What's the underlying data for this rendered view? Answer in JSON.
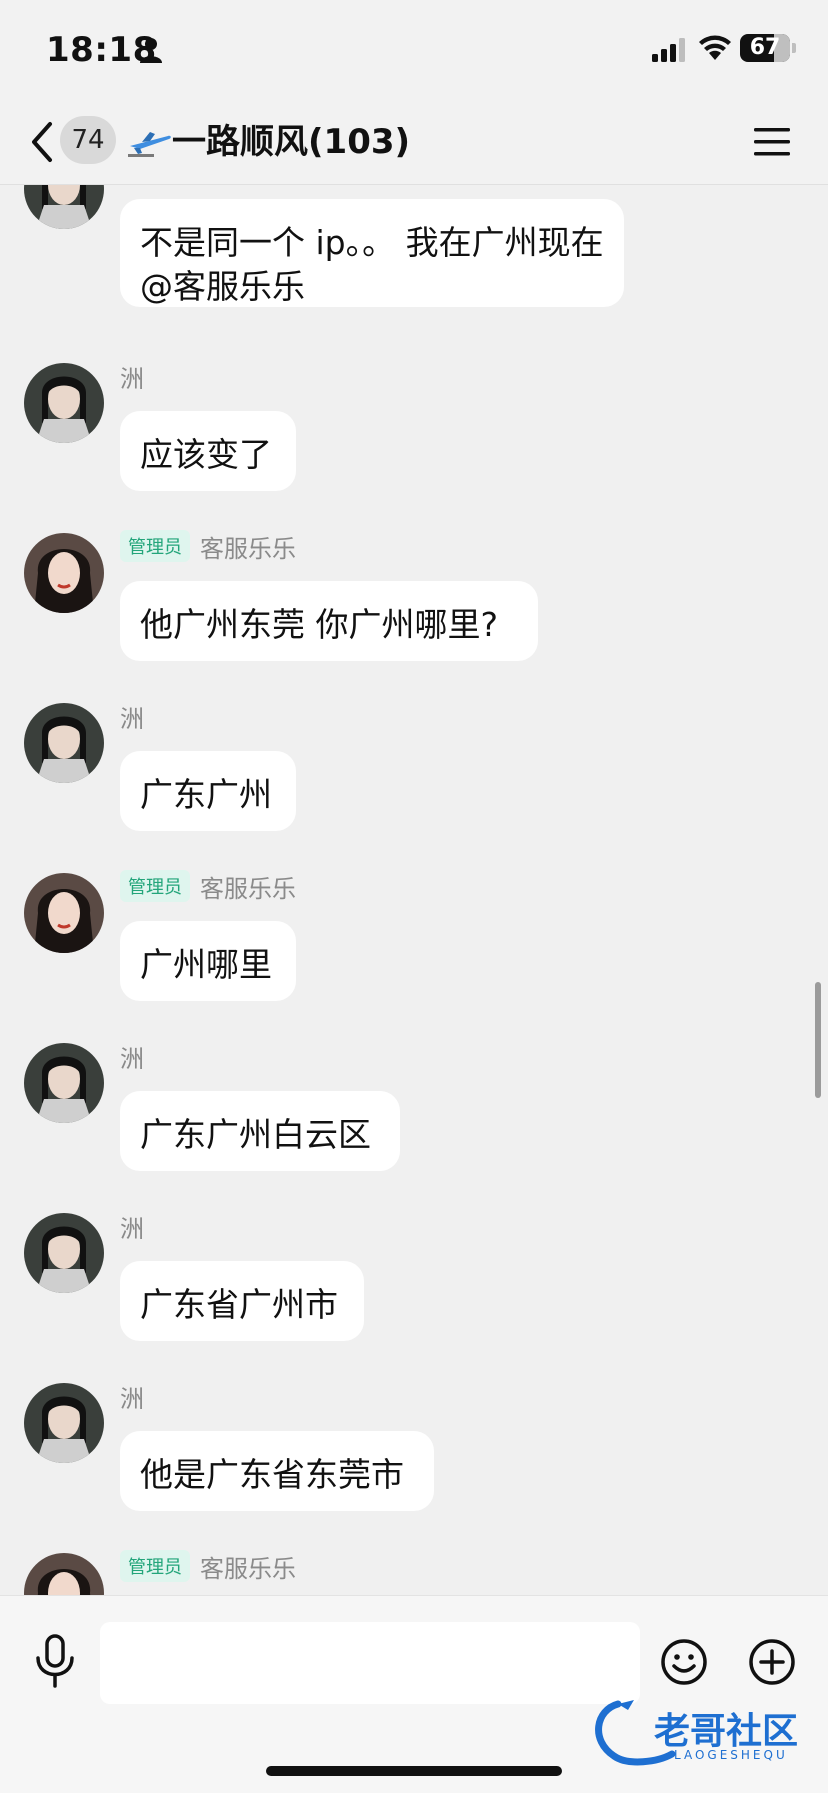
{
  "status_bar": {
    "time": "18:18",
    "battery": "67",
    "battery_level": 0.67
  },
  "header": {
    "back_label": "74",
    "title": "一路顺风(103)"
  },
  "messages": [
    {
      "name": "",
      "admin": "",
      "text": "不是同一个 ip。。 我在广州现在 @客服乐乐"
    },
    {
      "name": "洲",
      "admin": "",
      "text": "应该变了"
    },
    {
      "name": "客服乐乐",
      "admin": "管理员",
      "text": "他广州东莞 你广州哪里?"
    },
    {
      "name": "洲",
      "admin": "",
      "text": "广东广州"
    },
    {
      "name": "客服乐乐",
      "admin": "管理员",
      "text": "广州哪里"
    },
    {
      "name": "洲",
      "admin": "",
      "text": "广东广州白云区"
    },
    {
      "name": "洲",
      "admin": "",
      "text": "广东省广州市"
    },
    {
      "name": "洲",
      "admin": "",
      "text": "他是广东省东莞市"
    },
    {
      "name": "客服乐乐",
      "admin": "管理员",
      "text": ""
    }
  ],
  "input": {
    "placeholder": ""
  },
  "watermark": {
    "title": "老哥社区",
    "subtitle": "LAOGESHEQU"
  },
  "icons": {
    "back": "chevron-left-icon",
    "menu": "hamburger-menu-icon",
    "mic": "microphone-icon",
    "emoji": "smiley-icon",
    "plus": "plus-circle-icon",
    "scroll_down": "chevron-down-icon"
  },
  "colors": {
    "background": "#f0f0f0",
    "bubble": "#ffffff",
    "admin_tag_bg": "#dff5ee",
    "admin_tag_text": "#23a57a"
  }
}
